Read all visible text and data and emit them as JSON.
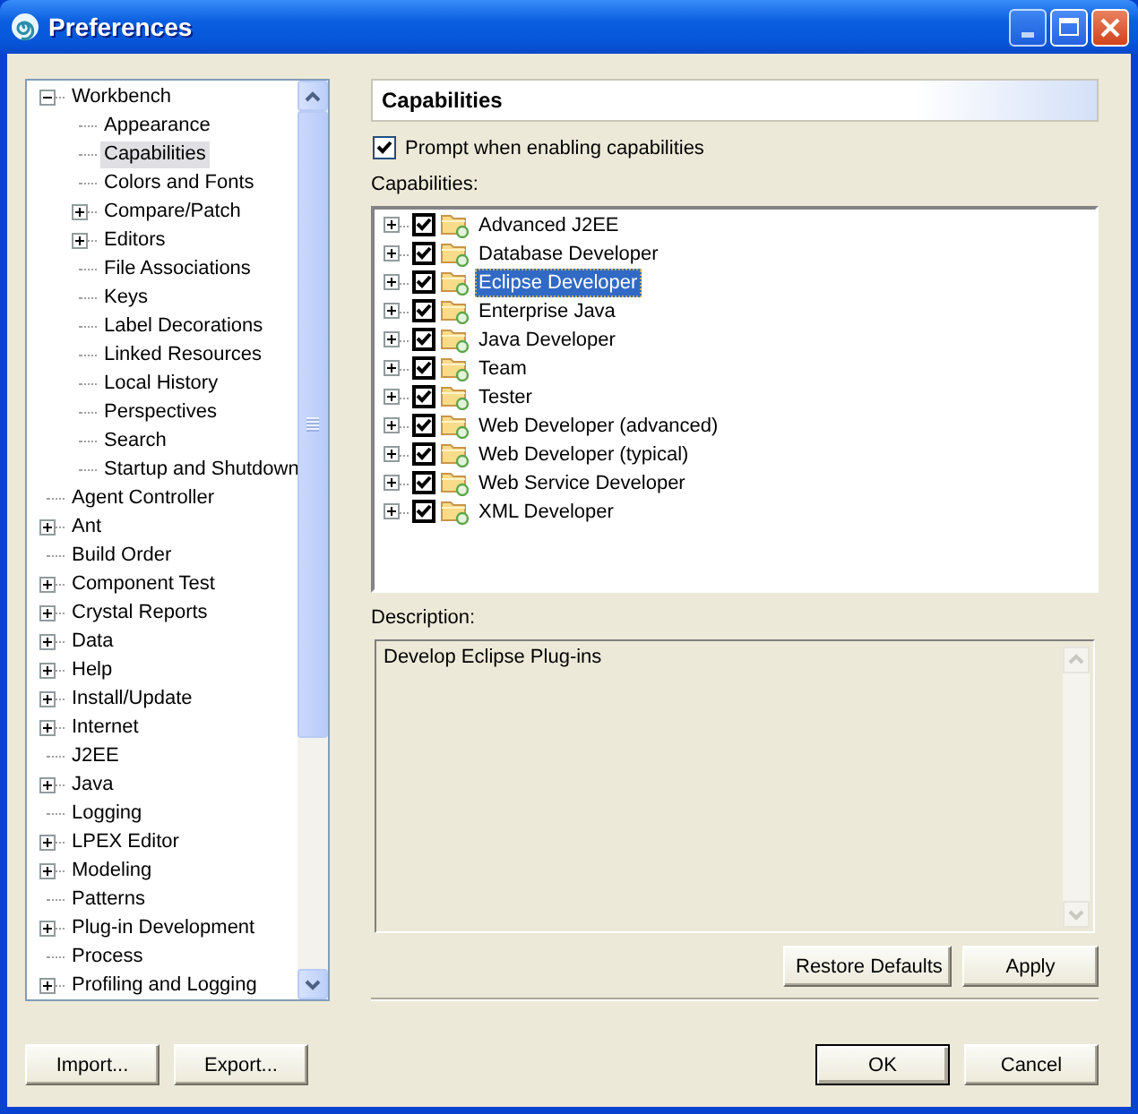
{
  "window": {
    "title": "Preferences"
  },
  "tree": {
    "items": [
      {
        "label": "Workbench",
        "kind": "branch",
        "expanded": true,
        "selected": false,
        "children": [
          {
            "label": "Appearance",
            "kind": "leaf",
            "selected": false
          },
          {
            "label": "Capabilities",
            "kind": "leaf",
            "selected": true
          },
          {
            "label": "Colors and Fonts",
            "kind": "leaf",
            "selected": false
          },
          {
            "label": "Compare/Patch",
            "kind": "branch",
            "expanded": false,
            "selected": false
          },
          {
            "label": "Editors",
            "kind": "branch",
            "expanded": false,
            "selected": false
          },
          {
            "label": "File Associations",
            "kind": "leaf",
            "selected": false
          },
          {
            "label": "Keys",
            "kind": "leaf",
            "selected": false
          },
          {
            "label": "Label Decorations",
            "kind": "leaf",
            "selected": false
          },
          {
            "label": "Linked Resources",
            "kind": "leaf",
            "selected": false
          },
          {
            "label": "Local History",
            "kind": "leaf",
            "selected": false
          },
          {
            "label": "Perspectives",
            "kind": "leaf",
            "selected": false
          },
          {
            "label": "Search",
            "kind": "leaf",
            "selected": false
          },
          {
            "label": "Startup and Shutdown",
            "kind": "leaf",
            "selected": false
          }
        ]
      },
      {
        "label": "Agent Controller",
        "kind": "leaf",
        "selected": false
      },
      {
        "label": "Ant",
        "kind": "branch",
        "expanded": false,
        "selected": false
      },
      {
        "label": "Build Order",
        "kind": "leaf",
        "selected": false
      },
      {
        "label": "Component Test",
        "kind": "branch",
        "expanded": false,
        "selected": false
      },
      {
        "label": "Crystal Reports",
        "kind": "branch",
        "expanded": false,
        "selected": false
      },
      {
        "label": "Data",
        "kind": "branch",
        "expanded": false,
        "selected": false
      },
      {
        "label": "Help",
        "kind": "branch",
        "expanded": false,
        "selected": false
      },
      {
        "label": "Install/Update",
        "kind": "branch",
        "expanded": false,
        "selected": false
      },
      {
        "label": "Internet",
        "kind": "branch",
        "expanded": false,
        "selected": false
      },
      {
        "label": "J2EE",
        "kind": "leaf",
        "selected": false
      },
      {
        "label": "Java",
        "kind": "branch",
        "expanded": false,
        "selected": false
      },
      {
        "label": "Logging",
        "kind": "leaf",
        "selected": false
      },
      {
        "label": "LPEX Editor",
        "kind": "branch",
        "expanded": false,
        "selected": false
      },
      {
        "label": "Modeling",
        "kind": "branch",
        "expanded": false,
        "selected": false
      },
      {
        "label": "Patterns",
        "kind": "leaf",
        "selected": false
      },
      {
        "label": "Plug-in Development",
        "kind": "branch",
        "expanded": false,
        "selected": false
      },
      {
        "label": "Process",
        "kind": "leaf",
        "selected": false
      },
      {
        "label": "Profiling and Logging",
        "kind": "branch",
        "expanded": false,
        "selected": false
      }
    ]
  },
  "page": {
    "title": "Capabilities",
    "prompt": {
      "label": "Prompt when enabling capabilities",
      "checked": true
    },
    "list_label": "Capabilities:",
    "capabilities": [
      {
        "label": "Advanced J2EE",
        "expanded": false,
        "checked": true,
        "selected": false
      },
      {
        "label": "Database Developer",
        "expanded": false,
        "checked": true,
        "selected": false
      },
      {
        "label": "Eclipse Developer",
        "expanded": false,
        "checked": true,
        "selected": true
      },
      {
        "label": "Enterprise Java",
        "expanded": false,
        "checked": true,
        "selected": false
      },
      {
        "label": "Java Developer",
        "expanded": false,
        "checked": true,
        "selected": false
      },
      {
        "label": "Team",
        "expanded": false,
        "checked": true,
        "selected": false
      },
      {
        "label": "Tester",
        "expanded": false,
        "checked": true,
        "selected": false
      },
      {
        "label": "Web Developer (advanced)",
        "expanded": false,
        "checked": true,
        "selected": false
      },
      {
        "label": "Web Developer (typical)",
        "expanded": false,
        "checked": true,
        "selected": false
      },
      {
        "label": "Web Service Developer",
        "expanded": false,
        "checked": true,
        "selected": false
      },
      {
        "label": "XML Developer",
        "expanded": false,
        "checked": true,
        "selected": false
      }
    ],
    "description_label": "Description:",
    "description": "Develop Eclipse Plug-ins",
    "buttons": [
      "Restore Defaults",
      "Apply"
    ]
  },
  "left_buttons": [
    "Import...",
    "Export..."
  ],
  "dialog_buttons": [
    {
      "label": "OK",
      "default": true
    },
    {
      "label": "Cancel",
      "default": false
    }
  ]
}
